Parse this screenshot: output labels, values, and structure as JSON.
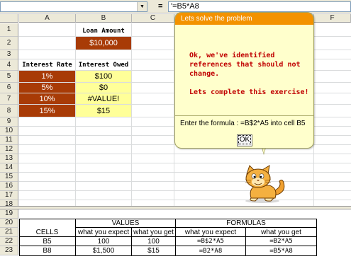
{
  "formula_bar": {
    "name_box": "",
    "equals": "=",
    "formula": "'=B5*A8"
  },
  "columns": [
    "A",
    "B",
    "C",
    "F"
  ],
  "rows": [
    "1",
    "2",
    "3",
    "4",
    "5",
    "6",
    "7",
    "8",
    "9",
    "10",
    "11",
    "12",
    "13",
    "14",
    "15",
    "16",
    "17",
    "18",
    "19",
    "20",
    "21",
    "22",
    "23"
  ],
  "sheet": {
    "loan_amount_label": "Loan Amount",
    "loan_amount_value": "$10,000",
    "interest_rate_label": "Interest Rate",
    "interest_owed_label": "Interest Owed",
    "rates": [
      "1%",
      "5%",
      "10%",
      "15%"
    ],
    "owed": [
      "$100",
      "$0",
      "#VALUE!",
      "$15"
    ]
  },
  "table": {
    "values_header": "VALUES",
    "formulas_header": "FORMULAS",
    "cells_header": "CELLS",
    "expect_header": "what you expect",
    "get_header": "what you get",
    "rows": [
      {
        "cell": "B5",
        "val_expect": "100",
        "val_get": "100",
        "f_expect": "=B$2*A5",
        "f_get": "=B2*A5"
      },
      {
        "cell": "B8",
        "val_expect": "$1,500",
        "val_get": "$15",
        "f_expect": "=B2*A8",
        "f_get": "=B5*A8"
      }
    ]
  },
  "callout": {
    "title": "Lets solve the problem",
    "message1": "Ok, we've identified references that should not change.",
    "message2": "Lets complete this exercise!",
    "instruction": "Enter the formula : =B$2*A5 into cell B5",
    "ok_label": "OK"
  },
  "colors": {
    "rust": "#a83b06",
    "yellow": "#ffff99",
    "callout_header": "#f39200",
    "callout_text": "#c00000"
  }
}
